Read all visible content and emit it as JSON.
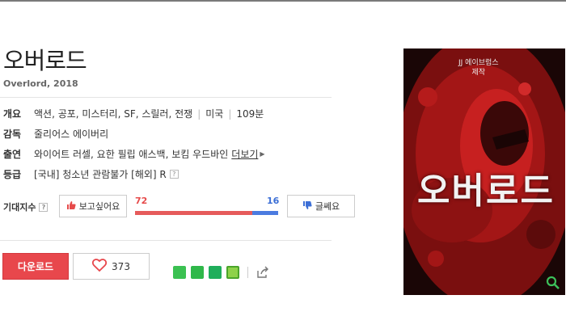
{
  "movie": {
    "title": "오버로드",
    "subtitle": "Overlord, 2018"
  },
  "info": {
    "overview": {
      "label": "개요",
      "genres": "액션, 공포, 미스터리, SF, 스릴러, 전쟁",
      "country": "미국",
      "runtime": "109분"
    },
    "director": {
      "label": "감독",
      "name": "줄리어스 에이버리"
    },
    "cast": {
      "label": "출연",
      "names": "와이어트 러셀, 요한 필립 애스백, 보킴 우드바인",
      "more": "더보기"
    },
    "rating": {
      "label": "등급",
      "text": "[국내] 청소년 관람불가 [해외] R"
    }
  },
  "expectation": {
    "label": "기대지수",
    "want_label": "보고싶어요",
    "dislike_label": "글쎄요",
    "want_count": "72",
    "dislike_count": "16",
    "want_ratio": 0.818
  },
  "actions": {
    "download_label": "다운로드",
    "like_count": "373"
  },
  "share_icons": [
    "band-icon",
    "kakaostory-icon",
    "bookmark-icon",
    "memo-icon",
    "share-out-icon"
  ],
  "poster": {
    "credit_line1": "JJ 에이브럼스",
    "credit_line2": "제작",
    "title": "오버로드"
  },
  "colors": {
    "accent_red": "#e8474c",
    "accent_blue": "#4b7be0"
  }
}
